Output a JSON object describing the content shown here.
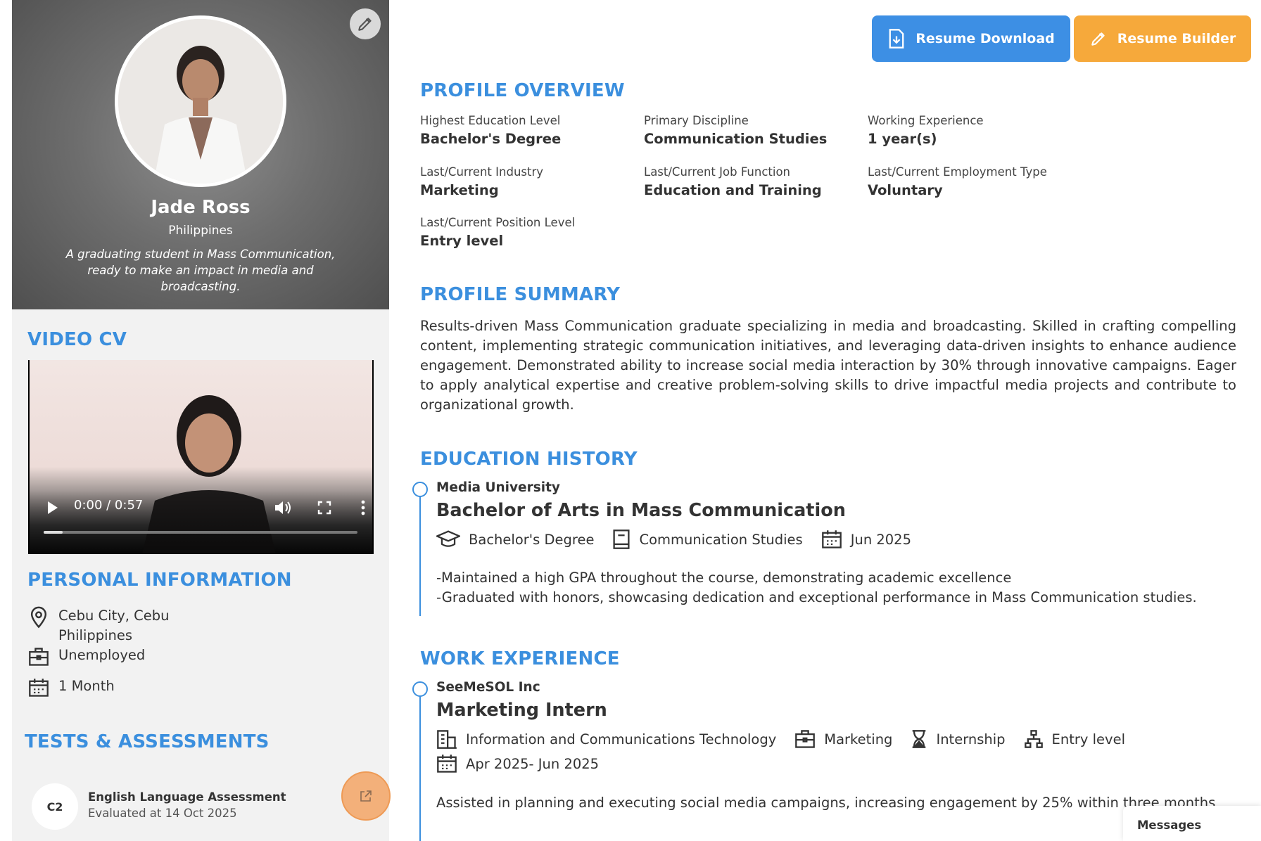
{
  "profile": {
    "name": "Jade Ross",
    "country": "Philippines",
    "bio": "A graduating student in Mass Communication, ready to make an impact in media and broadcasting."
  },
  "video_cv": {
    "title": "VIDEO CV",
    "time": "0:00 / 0:57",
    "progress_fraction": 0.06
  },
  "personal_info": {
    "title": "PERSONAL INFORMATION",
    "location_line1": "Cebu City, Cebu",
    "location_line2": "Philippines",
    "status": "Unemployed",
    "availability": "1 Month"
  },
  "tests": {
    "title": "TESTS & ASSESSMENTS",
    "items": [
      {
        "badge": "C2",
        "name": "English Language Assessment",
        "date": "Evaluated at 14 Oct 2025"
      }
    ]
  },
  "actions": {
    "download_label": "Resume Download",
    "builder_label": "Resume Builder",
    "download_color": "#3d8fe4",
    "builder_color": "#f6a93b"
  },
  "overview": {
    "title": "PROFILE OVERVIEW",
    "items": [
      {
        "label": "Highest Education Level",
        "value": "Bachelor's Degree"
      },
      {
        "label": "Primary Discipline",
        "value": "Communication Studies"
      },
      {
        "label": "Working Experience",
        "value": "1 year(s)"
      },
      {
        "label": "Last/Current Industry",
        "value": "Marketing"
      },
      {
        "label": "Last/Current Job Function",
        "value": "Education and Training"
      },
      {
        "label": "Last/Current Employment Type",
        "value": "Voluntary"
      },
      {
        "label": "Last/Current Position Level",
        "value": "Entry level"
      }
    ]
  },
  "summary": {
    "title": "PROFILE SUMMARY",
    "text": "Results-driven Mass Communication graduate specializing in media and broadcasting. Skilled in crafting compelling content, implementing strategic communication initiatives, and leveraging data-driven insights to enhance audience engagement. Demonstrated ability to increase social media interaction by 30% through innovative campaigns. Eager to apply analytical expertise and creative problem-solving skills to drive impactful media projects and contribute to organizational growth."
  },
  "education": {
    "title": "EDUCATION HISTORY",
    "school": "Media University",
    "degree": "Bachelor of Arts in Mass Communication",
    "level": "Bachelor's Degree",
    "field": "Communication Studies",
    "date": "Jun 2025",
    "desc_line1": "-Maintained a high GPA throughout the course, demonstrating academic excellence",
    "desc_line2": "-Graduated with honors, showcasing dedication and exceptional performance in Mass Communication studies."
  },
  "work": {
    "title": "WORK EXPERIENCE",
    "company": "SeeMeSOL Inc",
    "role": "Marketing Intern",
    "industry": "Information and Communications Technology",
    "function": "Marketing",
    "type": "Internship",
    "level": "Entry level",
    "dates": "Apr 2025- Jun 2025",
    "desc": "Assisted in planning and executing social media campaigns, increasing engagement by 25% within three months"
  },
  "messages_label": "Messages",
  "colors": {
    "accent": "#3b8fde",
    "badge_orange": "#f3b07a"
  }
}
